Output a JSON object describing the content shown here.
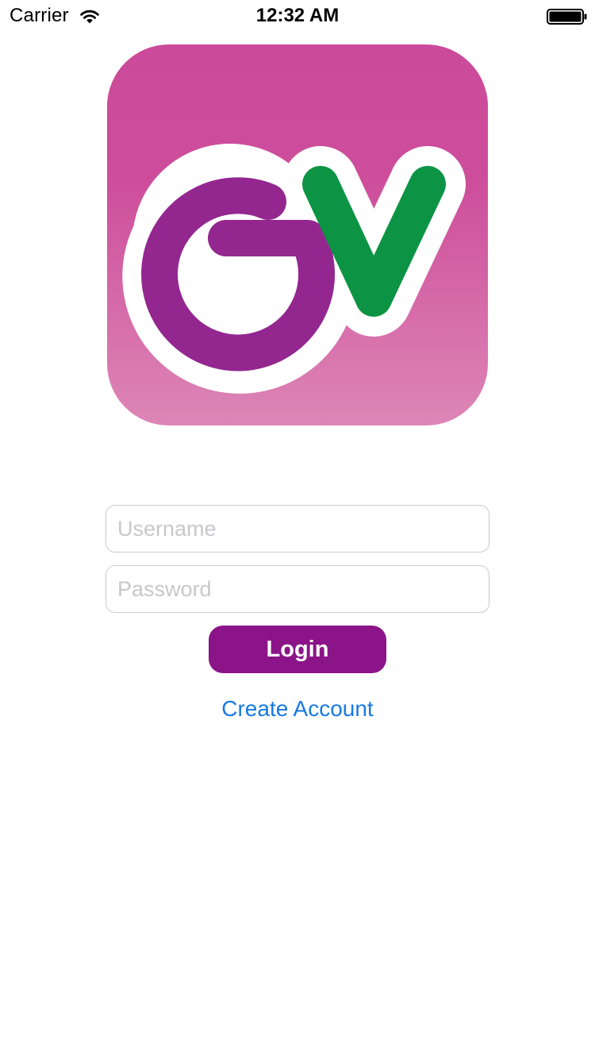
{
  "status_bar": {
    "carrier": "Carrier",
    "time": "12:32 AM",
    "icons": [
      "wifi-icon",
      "battery-icon"
    ]
  },
  "logo": {
    "text": "GV",
    "colors": {
      "background_top": "#cc4a9a",
      "background_bottom": "#dd86b6",
      "letter_g": "#93278f",
      "letter_v": "#0c9444",
      "outline": "#ffffff"
    }
  },
  "login_form": {
    "username_placeholder": "Username",
    "username_value": "",
    "password_placeholder": "Password",
    "password_value": "",
    "login_label": "Login",
    "create_account_label": "Create Account"
  },
  "colors": {
    "accent": "#8b1488",
    "link": "#1779e2",
    "field_border": "#cccccc",
    "placeholder": "#c7c7cd"
  }
}
